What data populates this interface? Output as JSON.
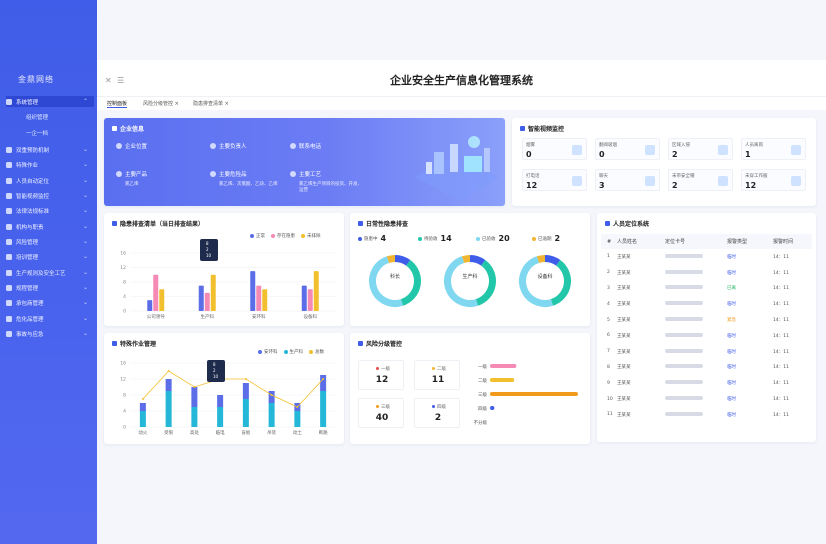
{
  "app": {
    "title": "企业安全生产信息化管理系统"
  },
  "sidebar": {
    "items": [
      {
        "label": "系统管理",
        "icon": "gear-icon",
        "sub": [
          "组织管理",
          "一企一档"
        ]
      },
      {
        "label": "双重预防机制",
        "icon": "shield-icon"
      },
      {
        "label": "特殊作业",
        "icon": "tool-icon"
      },
      {
        "label": "人员自动定位",
        "icon": "location-icon"
      },
      {
        "label": "智能视频监控",
        "icon": "camera-icon"
      },
      {
        "label": "法律法规标准",
        "icon": "book-icon"
      },
      {
        "label": "机构与职责",
        "icon": "org-icon"
      },
      {
        "label": "风险管理",
        "icon": "warning-icon"
      },
      {
        "label": "培训管理",
        "icon": "training-icon"
      },
      {
        "label": "生产规则及安全工艺",
        "icon": "process-icon"
      },
      {
        "label": "规程管理",
        "icon": "doc-icon"
      },
      {
        "label": "承包商管理",
        "icon": "contractor-icon"
      },
      {
        "label": "危化品管理",
        "icon": "chemical-icon"
      },
      {
        "label": "事故与应急",
        "icon": "alarm-icon"
      }
    ]
  },
  "tabs": [
    "控制面板",
    "风险分级管控",
    "隐患排查清单"
  ],
  "enterprise": {
    "title": "企业信息",
    "fields": [
      {
        "label": "企业位置",
        "value": "",
        "icon": "location-icon"
      },
      {
        "label": "主要负责人",
        "value": "",
        "icon": "user-icon"
      },
      {
        "label": "联系电话",
        "value": "",
        "icon": "phone-icon"
      },
      {
        "label": "主要产品",
        "value": "氯乙烯",
        "icon": "product-icon"
      },
      {
        "label": "主要危险品",
        "value": "氯乙烯、次氯酸、乙炔、乙烯",
        "icon": "hazard-icon"
      },
      {
        "label": "主要工艺",
        "value": "氯乙烯生产项目的投资、开发、运营",
        "icon": "process-icon"
      }
    ]
  },
  "video": {
    "title": "智能视频监控",
    "tiles": [
      {
        "label": "烟雾",
        "value": "0"
      },
      {
        "label": "翻阅吸烟",
        "value": "0"
      },
      {
        "label": "区域入侵",
        "value": "2"
      },
      {
        "label": "人员离岗",
        "value": "1"
      },
      {
        "label": "打电话",
        "value": "12"
      },
      {
        "label": "聊天",
        "value": "3"
      },
      {
        "label": "未带安全帽",
        "value": "2"
      },
      {
        "label": "未穿工作服",
        "value": "12"
      }
    ]
  },
  "hazard_list": {
    "title": "隐患排查清单（当日排查结果）",
    "legend": [
      "正常",
      "存在隐患",
      "未排除"
    ],
    "tooltip": [
      "8",
      "2",
      "10"
    ]
  },
  "daily_check": {
    "title": "日常性隐患排查",
    "stats": [
      {
        "label": "隐患中",
        "value": "4",
        "color": "#3f5de8"
      },
      {
        "label": "待验收",
        "value": "14",
        "color": "#22c7a9"
      },
      {
        "label": "已验收",
        "value": "20",
        "color": "#7fd8f0"
      },
      {
        "label": "已逾期",
        "value": "2",
        "color": "#f2b531"
      }
    ],
    "donuts": [
      "科长",
      "生产科",
      "设备科"
    ]
  },
  "positioning": {
    "title": "人员定位系统",
    "columns": [
      "#",
      "人员姓名",
      "定位卡号",
      "报警类型",
      "报警时间"
    ],
    "rows": [
      {
        "no": "1",
        "name": "王某某",
        "type": "临时",
        "time": "14：11",
        "color": "#3f5de8"
      },
      {
        "no": "2",
        "name": "王某某",
        "type": "临时",
        "time": "14：11",
        "color": "#3f5de8"
      },
      {
        "no": "3",
        "name": "王某某",
        "type": "已离",
        "time": "14：11",
        "color": "#22b35e"
      },
      {
        "no": "4",
        "name": "王某某",
        "type": "临时",
        "time": "14：11",
        "color": "#3f5de8"
      },
      {
        "no": "5",
        "name": "王某某",
        "type": "紧急",
        "time": "14：11",
        "color": "#f29a1b"
      },
      {
        "no": "6",
        "name": "王某某",
        "type": "临时",
        "time": "14：11",
        "color": "#3f5de8"
      },
      {
        "no": "7",
        "name": "王某某",
        "type": "临时",
        "time": "14：11",
        "color": "#3f5de8"
      },
      {
        "no": "8",
        "name": "王某某",
        "type": "临时",
        "time": "14：11",
        "color": "#3f5de8"
      },
      {
        "no": "9",
        "name": "王某某",
        "type": "临时",
        "time": "14：11",
        "color": "#3f5de8"
      },
      {
        "no": "10",
        "name": "王某某",
        "type": "临时",
        "time": "14：11",
        "color": "#3f5de8"
      },
      {
        "no": "11",
        "name": "王某某",
        "type": "临时",
        "time": "14：11",
        "color": "#3f5de8"
      }
    ]
  },
  "special_work": {
    "title": "特殊作业管理",
    "legend": [
      "安环科",
      "生产科",
      "总数"
    ],
    "tooltip": [
      "8",
      "2",
      "10"
    ]
  },
  "risk": {
    "title": "风险分级管控",
    "tiles": [
      {
        "label": "一级",
        "value": "12",
        "color": "#e84a4a"
      },
      {
        "label": "二级",
        "value": "11",
        "color": "#f2b531"
      },
      {
        "label": "三级",
        "value": "40",
        "color": "#f29a1b"
      },
      {
        "label": "四级",
        "value": "2",
        "color": "#3f5de8"
      }
    ]
  },
  "chart_data": [
    {
      "type": "bar",
      "title": "隐患排查清单（当日排查结果）",
      "categories": [
        "公司领导",
        "生产科",
        "安环科",
        "设备科"
      ],
      "series": [
        {
          "name": "正常",
          "values": [
            3,
            7,
            11,
            7
          ]
        },
        {
          "name": "存在隐患",
          "values": [
            10,
            5,
            7,
            6
          ]
        },
        {
          "name": "未排除",
          "values": [
            6,
            10,
            6,
            11
          ]
        }
      ],
      "ylim": [
        0,
        16
      ],
      "yticks": [
        0,
        4,
        8,
        12,
        16
      ]
    },
    {
      "type": "bar",
      "title": "特殊作业管理",
      "categories": [
        "动火",
        "受限",
        "高处",
        "临电",
        "盲板",
        "吊装",
        "动土",
        "断路"
      ],
      "series": [
        {
          "name": "安环科",
          "values": [
            2,
            3,
            5,
            3,
            4,
            3,
            2,
            4
          ]
        },
        {
          "name": "生产科",
          "values": [
            4,
            9,
            5,
            5,
            7,
            6,
            4,
            9
          ]
        },
        {
          "name": "总数",
          "values": [
            6,
            12,
            10,
            8,
            11,
            9,
            6,
            13
          ]
        }
      ],
      "line": {
        "name": "总数",
        "values": [
          7,
          14,
          10,
          12,
          12,
          8,
          5,
          12
        ]
      },
      "ylim": [
        0,
        16
      ],
      "yticks": [
        0,
        4,
        8,
        12,
        16
      ]
    },
    {
      "type": "pie",
      "title": "日常性隐患排查",
      "donuts": [
        {
          "name": "科长",
          "values": [
            4,
            14,
            20,
            2
          ]
        },
        {
          "name": "生产科",
          "values": [
            4,
            14,
            20,
            2
          ]
        },
        {
          "name": "设备科",
          "values": [
            4,
            14,
            20,
            2
          ]
        }
      ]
    },
    {
      "type": "bar",
      "title": "风险分级管控",
      "categories": [
        "一级",
        "二级",
        "三级",
        "四级",
        "不分级"
      ],
      "values": [
        12,
        11,
        40,
        2,
        0
      ]
    }
  ]
}
